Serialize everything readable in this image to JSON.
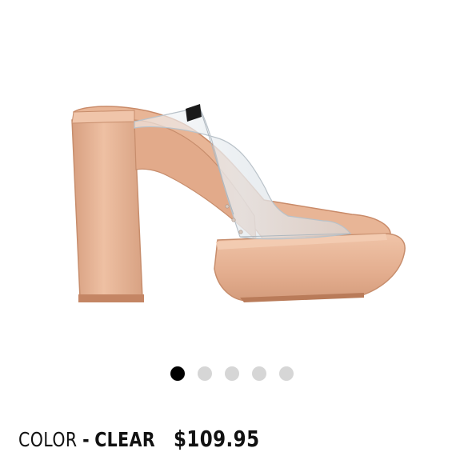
{
  "product": {
    "image_icon": "shoe-product-image",
    "colors": {
      "patent": "#e6b597",
      "patent_shadow": "#cf9474",
      "sole_edge": "#b87a57",
      "clear_strap": "#dfe5ea",
      "logo": "#1a1a1a",
      "active_dot": "#000000",
      "inactive_dot": "#d6d6d6"
    },
    "slide_count": 5,
    "active_slide": 1
  },
  "details": {
    "color_label": "COLOR",
    "separator": "-",
    "color_value": "CLEAR",
    "price": "$109.95"
  }
}
